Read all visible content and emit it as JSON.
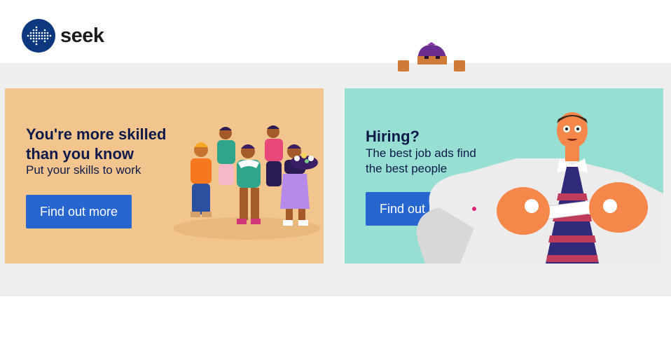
{
  "brand": {
    "name": "seek",
    "color": "#0d3880"
  },
  "promos": [
    {
      "title": "You're more skilled than you know",
      "subtitle": "Put your skills to work",
      "button_label": "Find out more",
      "background": "#f3c58e"
    },
    {
      "title": "Hiring?",
      "subtitle": "The best job ads find the best people",
      "button_label": "Find out more",
      "background": "#98dfd3"
    }
  ],
  "colors": {
    "button": "#2765cf",
    "text": "#0d1a4a",
    "band": "#eeeeee"
  }
}
